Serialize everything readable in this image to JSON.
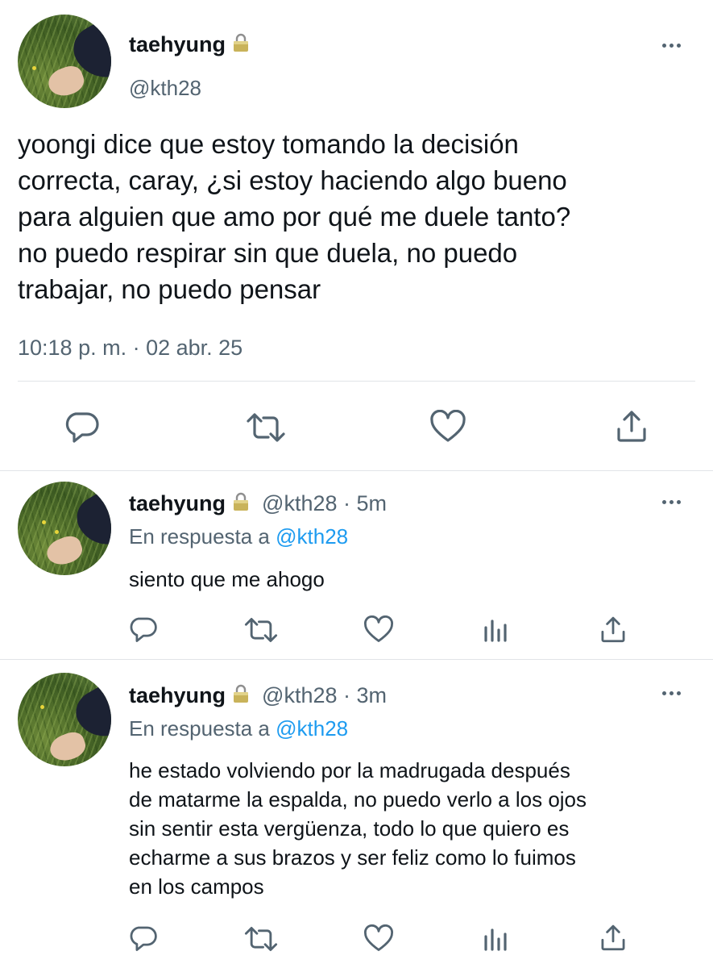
{
  "main_tweet": {
    "display_name": "taehyung",
    "handle": "@kth28",
    "text": "yoongi dice que estoy tomando la decisión correcta, caray, ¿si estoy haciendo algo bueno para alguien que amo por qué me duele tanto? no puedo respirar sin que duela, no puedo trabajar, no puedo pensar",
    "text_lines": [
      "yoongi dice que estoy tomando la decisión",
      "correcta, caray, ¿si estoy haciendo algo bueno",
      "para alguien que amo por qué me duele tanto?",
      "no puedo respirar sin que duela, no puedo",
      "trabajar, no puedo pensar"
    ],
    "timestamp": "10:18 p. m. · 02 abr. 25"
  },
  "replies": [
    {
      "display_name": "taehyung",
      "handle_time": "@kth28 · 5m",
      "reply_prefix": "En respuesta a",
      "reply_to": "@kth28",
      "text_lines": [
        "siento que me ahogo"
      ]
    },
    {
      "display_name": "taehyung",
      "handle_time": "@kth28 · 3m",
      "reply_prefix": "En respuesta a",
      "reply_to": "@kth28",
      "text_lines": [
        "he estado volviendo por la madrugada después",
        "de matarme la espalda, no puedo verlo a los ojos",
        "sin sentir esta vergüenza, todo lo que quiero es",
        "echarme a sus brazos y ser feliz como lo fuimos",
        "en los campos"
      ]
    }
  ],
  "icons": {
    "reply": "reply-icon",
    "retweet": "retweet-icon",
    "like": "like-icon",
    "analytics": "analytics-icon",
    "share": "share-icon",
    "more": "more-icon",
    "lock": "lock-icon"
  },
  "colors": {
    "text": "#0f1419",
    "secondary": "#536471",
    "link": "#1d9bf0",
    "divider": "#e1e4e8"
  }
}
